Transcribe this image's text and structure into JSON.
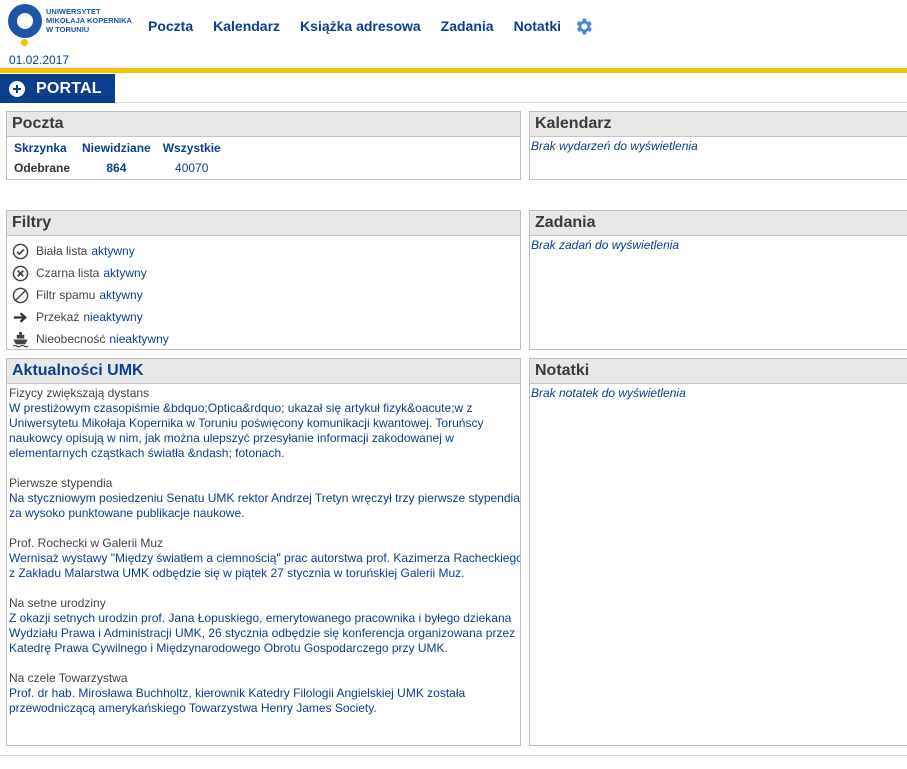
{
  "header": {
    "logo_lines": [
      "UNIWERSYTET",
      "MIKOŁAJA KOPERNIKA",
      "W TORUNIU"
    ],
    "nav": [
      "Poczta",
      "Kalendarz",
      "Książka adresowa",
      "Zadania",
      "Notatki"
    ],
    "settings_icon": "gear-icon",
    "date": "01.02.2017"
  },
  "portal": {
    "label": "PORTAL",
    "icon": "plus-circle-icon"
  },
  "mail": {
    "title": "Poczta",
    "columns": [
      "Skrzynka",
      "Niewidziane",
      "Wszystkie"
    ],
    "rows": [
      {
        "box": "Odebrane",
        "unread": "864",
        "all": "40070"
      }
    ]
  },
  "calendar": {
    "title": "Kalendarz",
    "empty": "Brak wydarzeń do wyświetlenia"
  },
  "filters": {
    "title": "Filtry",
    "items": [
      {
        "icon": "check-circle-icon",
        "label": "Biała lista",
        "status": "aktywny"
      },
      {
        "icon": "x-circle-icon",
        "label": "Czarna lista",
        "status": "aktywny"
      },
      {
        "icon": "no-entry-icon",
        "label": "Filtr spamu",
        "status": "aktywny"
      },
      {
        "icon": "arrow-right-icon",
        "label": "Przekaż",
        "status": "nieaktywny"
      },
      {
        "icon": "ship-icon",
        "label": "Nieobecność",
        "status": "nieaktywny"
      }
    ]
  },
  "tasks": {
    "title": "Zadania",
    "empty": "Brak zadań do wyświetlenia"
  },
  "news": {
    "title": "Aktualności UMK",
    "items": [
      {
        "title": "Fizycy zwiększają dystans",
        "body": "W prestiżowym czasopiśmie &bdquo;Optica&rdquo; ukazał się artykuł fizyk&oacute;w z Uniwersytetu Mikołaja Kopernika w Toruniu poświęcony komunikacji kwantowej. Toruńscy naukowcy opisują w nim, jak można ulepszyć przesyłanie informacji zakodowanej w elementarnych cząstkach światła &ndash; fotonach."
      },
      {
        "title": "Pierwsze stypendia",
        "body": "Na styczniowym posiedzeniu Senatu UMK rektor Andrzej Tretyn wręczył trzy pierwsze stypendia za wysoko punktowane publikacje naukowe."
      },
      {
        "title": "Prof. Rochecki w Galerii Muz",
        "body": "Wernisaż wystawy \"Między światłem a ciemnością\" prac autorstwa prof. Kazimerza Racheckiego z Zakładu Malarstwa UMK odbędzie się w piątek 27 stycznia w toruńskiej Galerii Muz."
      },
      {
        "title": "Na setne urodziny",
        "body": "Z okazji setnych urodzin prof. Jana Łopuskiego, emerytowanego pracownika i byłego dziekana Wydziału Prawa i Administracji UMK, 26 stycznia odbędzie się konferencja organizowana przez Katedrę Prawa Cywilnego i Międzynarodowego Obrotu Gospodarczego przy UMK."
      },
      {
        "title": "Na czele Towarzystwa",
        "body": "Prof. dr hab. Mirosława Buchholtz, kierownik Katedry Filologii Angielskiej UMK została przewodniczącą amerykańskiego Towarzystwa Henry James Society."
      }
    ]
  },
  "notes": {
    "title": "Notatki",
    "empty": "Brak notatek do wyświetlenia"
  },
  "colors": {
    "brand_blue": "#0c3e8e",
    "accent_yellow": "#f2c500"
  }
}
